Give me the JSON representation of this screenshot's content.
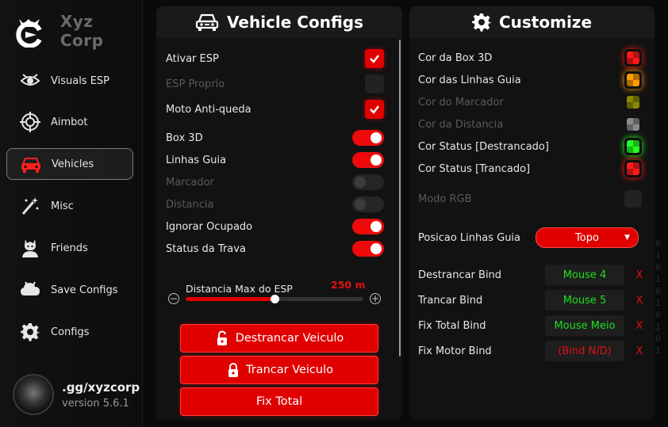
{
  "brand": {
    "name": "Xyz Corp",
    "logo_icon": "claw-logo-icon"
  },
  "sidebar": {
    "items": [
      {
        "label": "Visuals ESP",
        "icon": "eye-icon",
        "active": false
      },
      {
        "label": "Aimbot",
        "icon": "crosshair-icon",
        "active": false
      },
      {
        "label": "Vehicles",
        "icon": "car-icon",
        "active": true
      },
      {
        "label": "Misc",
        "icon": "wand-icon",
        "active": false
      },
      {
        "label": "Friends",
        "icon": "friends-icon",
        "active": false
      },
      {
        "label": "Save Configs",
        "icon": "cloud-icon",
        "active": false
      },
      {
        "label": "Configs",
        "icon": "gear-icon",
        "active": false
      }
    ]
  },
  "profile": {
    "name": ".gg/xyzcorp",
    "version": "version 5.6.1"
  },
  "vehicle_panel": {
    "title": "Vehicle Configs",
    "title_icon": "car-icon",
    "checkboxes": [
      {
        "label": "Ativar ESP",
        "checked": true,
        "enabled": true
      },
      {
        "label": "ESP Proprio",
        "checked": false,
        "enabled": false
      },
      {
        "label": "Moto Anti-queda",
        "checked": true,
        "enabled": true
      }
    ],
    "toggles": [
      {
        "label": "Box 3D",
        "on": true,
        "enabled": true
      },
      {
        "label": "Linhas Guia",
        "on": true,
        "enabled": true
      },
      {
        "label": "Marcador",
        "on": false,
        "enabled": false
      },
      {
        "label": "Distancia",
        "on": false,
        "enabled": false
      },
      {
        "label": "Ignorar Ocupado",
        "on": true,
        "enabled": true
      },
      {
        "label": "Status da Trava",
        "on": true,
        "enabled": true
      }
    ],
    "slider": {
      "label": "Distancia Max do ESP",
      "value_text": "250 m",
      "fraction": 0.5,
      "minus": "−",
      "plus": "+"
    },
    "buttons": [
      {
        "label": "Destrancar Veiculo",
        "icon": "unlock-icon"
      },
      {
        "label": "Trancar Veiculo",
        "icon": "lock-icon"
      },
      {
        "label": "Fix Total",
        "icon": ""
      }
    ]
  },
  "customize_panel": {
    "title": "Customize",
    "title_icon": "gear-icon",
    "colors": [
      {
        "label": "Cor da Box 3D",
        "color": "#ff1a1a",
        "enabled": true
      },
      {
        "label": "Cor das Linhas Guia",
        "color": "#ff9900",
        "enabled": true
      },
      {
        "label": "Cor do Marcador",
        "color": "#8a8a00",
        "enabled": false
      },
      {
        "label": "Cor da Distancia",
        "color": "#8a8a8a",
        "enabled": false
      },
      {
        "label": "Cor Status [Destrancado]",
        "color": "#22ff22",
        "enabled": true
      },
      {
        "label": "Cor Status [Trancado]",
        "color": "#ff1a1a",
        "enabled": true
      }
    ],
    "rgb": {
      "label": "Modo RGB",
      "checked": false,
      "enabled": false
    },
    "guide_position": {
      "label": "Posicao Linhas Guia",
      "value": "Topo",
      "arrow": "▼"
    },
    "binds": [
      {
        "label": "Destrancar Bind",
        "value": "Mouse 4",
        "color": "#1ee01e",
        "clear": "X"
      },
      {
        "label": "Trancar Bind",
        "value": "Mouse 5",
        "color": "#1ee01e",
        "clear": "X"
      },
      {
        "label": "Fix Total Bind",
        "value": "Mouse Meio",
        "color": "#1ee01e",
        "clear": "X"
      },
      {
        "label": "Fix Motor Bind",
        "value": "(Bind N/D)",
        "color": "#e01010",
        "clear": "X"
      }
    ]
  },
  "colors": {
    "accent": "#e00000",
    "background": "#0a0a0a"
  }
}
